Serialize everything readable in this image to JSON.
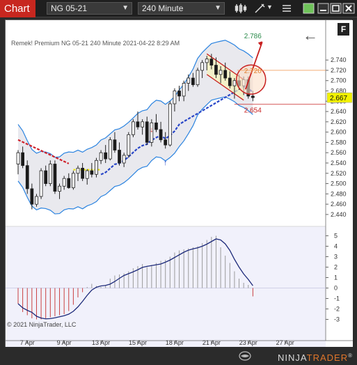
{
  "toolbar": {
    "title": "Chart",
    "instrument": "NG 05-21",
    "interval": "240 Minute"
  },
  "overlay": {
    "label": "Remek!  Premium  NG 05-21  240 Minute  2021-04-22 8:29 AM"
  },
  "copyright": "© 2021 NinjaTrader, LLC",
  "f_button": "F",
  "logo": {
    "ninja": "NINJA",
    "trader": "TRADER",
    "reg": "®"
  },
  "colors": {
    "accent": "#c7271f",
    "bull_candle": "#1a1a1a",
    "bear_candle": "#1a1a1a",
    "band_line": "#2a83e0",
    "trail_red": "#d0202a",
    "trail_blue": "#2846c8",
    "trail_yellow": "#e8e200",
    "osc_line": "#1d2a7a",
    "current_price_bg": "#f2f200"
  },
  "chart_data": {
    "type": "candlestick",
    "price_axis_ticks": [
      "2.740",
      "2.720",
      "2.700",
      "2.680",
      "2.660",
      "2.640",
      "2.620",
      "2.600",
      "2.580",
      "2.560",
      "2.540",
      "2.520",
      "2.500",
      "2.480",
      "2.460",
      "2.440"
    ],
    "price_ylim": [
      2.425,
      2.77
    ],
    "osc_axis_ticks": [
      "5",
      "4",
      "3",
      "2",
      "1",
      "0",
      "-1",
      "-2",
      "-3"
    ],
    "osc_ylim": [
      -3.7,
      5.5
    ],
    "x_tick_labels": [
      "7 Apr",
      "9 Apr",
      "13 Apr",
      "15 Apr",
      "18 Apr",
      "21 Apr",
      "23 Apr",
      "27 Apr"
    ],
    "annotations": {
      "upper_band_value": "2.786",
      "mid_label_value": "2.720",
      "current_price": "2.667",
      "lower_band_value": "2.654"
    },
    "candles": [
      [
        2.538,
        2.565,
        2.518,
        2.56
      ],
      [
        2.56,
        2.572,
        2.53,
        2.535
      ],
      [
        2.535,
        2.545,
        2.48,
        2.49
      ],
      [
        2.49,
        2.5,
        2.45,
        2.46
      ],
      [
        2.46,
        2.48,
        2.455,
        2.475
      ],
      [
        2.475,
        2.53,
        2.47,
        2.525
      ],
      [
        2.525,
        2.535,
        2.495,
        2.5
      ],
      [
        2.5,
        2.545,
        2.495,
        2.538
      ],
      [
        2.538,
        2.545,
        2.48,
        2.485
      ],
      [
        2.485,
        2.5,
        2.47,
        2.495
      ],
      [
        2.495,
        2.515,
        2.488,
        2.51
      ],
      [
        2.51,
        2.52,
        2.49,
        2.492
      ],
      [
        2.492,
        2.525,
        2.488,
        2.52
      ],
      [
        2.52,
        2.535,
        2.505,
        2.53
      ],
      [
        2.53,
        2.54,
        2.505,
        2.51
      ],
      [
        2.51,
        2.528,
        2.498,
        2.525
      ],
      [
        2.525,
        2.54,
        2.512,
        2.518
      ],
      [
        2.518,
        2.55,
        2.512,
        2.545
      ],
      [
        2.545,
        2.565,
        2.538,
        2.56
      ],
      [
        2.56,
        2.575,
        2.54,
        2.548
      ],
      [
        2.548,
        2.59,
        2.545,
        2.585
      ],
      [
        2.585,
        2.6,
        2.56,
        2.565
      ],
      [
        2.565,
        2.58,
        2.535,
        2.54
      ],
      [
        2.54,
        2.56,
        2.532,
        2.555
      ],
      [
        2.555,
        2.6,
        2.55,
        2.595
      ],
      [
        2.595,
        2.625,
        2.59,
        2.62
      ],
      [
        2.62,
        2.64,
        2.605,
        2.61
      ],
      [
        2.61,
        2.625,
        2.595,
        2.62
      ],
      [
        2.62,
        2.63,
        2.575,
        2.58
      ],
      [
        2.58,
        2.625,
        2.572,
        2.618
      ],
      [
        2.618,
        2.635,
        2.6,
        2.605
      ],
      [
        2.605,
        2.62,
        2.58,
        2.585
      ],
      [
        2.585,
        2.6,
        2.568,
        2.575
      ],
      [
        2.575,
        2.66,
        2.572,
        2.655
      ],
      [
        2.655,
        2.685,
        2.64,
        2.68
      ],
      [
        2.68,
        2.69,
        2.66,
        2.67
      ],
      [
        2.67,
        2.7,
        2.66,
        2.695
      ],
      [
        2.695,
        2.712,
        2.68,
        2.705
      ],
      [
        2.705,
        2.715,
        2.688,
        2.692
      ],
      [
        2.692,
        2.725,
        2.688,
        2.72
      ],
      [
        2.72,
        2.74,
        2.705,
        2.735
      ],
      [
        2.735,
        2.748,
        2.72,
        2.742
      ],
      [
        2.742,
        2.752,
        2.722,
        2.73
      ],
      [
        2.73,
        2.745,
        2.705,
        2.712
      ],
      [
        2.712,
        2.728,
        2.695,
        2.72
      ],
      [
        2.72,
        2.735,
        2.7,
        2.705
      ],
      [
        2.705,
        2.718,
        2.685,
        2.69
      ],
      [
        2.69,
        2.705,
        2.665,
        2.7
      ],
      [
        2.7,
        2.712,
        2.682,
        2.69
      ],
      [
        2.69,
        2.708,
        2.672,
        2.702
      ],
      [
        2.702,
        2.708,
        2.665,
        2.67
      ],
      [
        2.67,
        2.68,
        2.66,
        2.667
      ]
    ],
    "oscillator": [
      -1.5,
      -2.3,
      -2.6,
      -2.9,
      -3.0,
      -3.0,
      -2.9,
      -2.8,
      -2.7,
      -2.6,
      -2.5,
      -2.2,
      -1.6,
      -0.9,
      -0.4,
      0.1,
      0.4,
      0.2,
      0.1,
      0.3,
      0.9,
      1.2,
      1.3,
      1.4,
      1.6,
      1.9,
      2.1,
      2.3,
      2.0,
      2.2,
      2.4,
      2.6,
      2.7,
      3.0,
      3.4,
      3.6,
      3.7,
      3.8,
      3.9,
      4.0,
      4.3,
      4.6,
      4.9,
      5.0,
      3.9,
      3.1,
      2.4,
      1.6,
      0.9,
      0.5,
      0.3,
      -0.8
    ]
  }
}
